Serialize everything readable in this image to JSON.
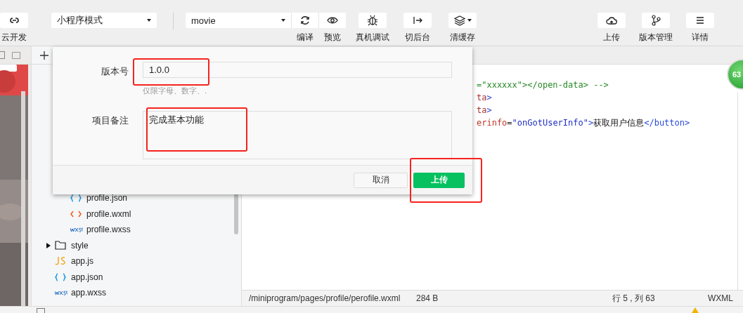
{
  "toolbar": {
    "left_tools": [
      {
        "label": "云开发",
        "kind": "cloud-dev",
        "has_menu": false
      }
    ],
    "mode_select": {
      "value": "小程序模式"
    },
    "project_select": {
      "value": "movie"
    },
    "project_tools": [
      {
        "label": "编译",
        "kind": "compile",
        "has_menu": false
      },
      {
        "label": "预览",
        "kind": "preview",
        "has_menu": false
      }
    ],
    "tools": [
      {
        "label": "真机调试",
        "kind": "debug",
        "has_menu": false
      },
      {
        "label": "切后台",
        "kind": "background",
        "has_menu": false
      },
      {
        "label": "清缓存",
        "kind": "cache",
        "has_menu": true
      }
    ],
    "right_tools": [
      {
        "label": "上传",
        "kind": "upload",
        "has_menu": false
      },
      {
        "label": "版本管理",
        "kind": "versions",
        "has_menu": false
      },
      {
        "label": "详情",
        "kind": "details",
        "has_menu": false
      }
    ]
  },
  "file_tree": [
    {
      "children": [
        {
          "name": "profile.json",
          "kind": "json"
        },
        {
          "name": "profile.wxml",
          "kind": "wxml"
        },
        {
          "name": "profile.wxss",
          "kind": "wxss"
        }
      ]
    },
    {
      "name": "style",
      "kind": "folder",
      "expanded": false
    },
    {
      "name": "app.js",
      "kind": "js"
    },
    {
      "name": "app.json",
      "kind": "json"
    },
    {
      "name": "app.wxss",
      "kind": "wxss"
    }
  ],
  "editor": {
    "code_lines": [
      [
        {
          "text": "=\"xxxxxx\"></open-data> -->",
          "kind": "comment"
        }
      ],
      [
        {
          "text": "ta",
          "kind": "tag"
        },
        {
          "text": ">",
          "kind": "bracket"
        }
      ],
      [
        {
          "text": "ta",
          "kind": "tag"
        },
        {
          "text": ">",
          "kind": "bracket"
        }
      ],
      [
        {
          "text": "erinfo",
          "kind": "attr"
        },
        {
          "text": "=",
          "kind": "plain"
        },
        {
          "text": "\"onGotUserInfo\"",
          "kind": "string"
        },
        {
          "text": ">",
          "kind": "bracket"
        },
        {
          "text": "获取用户信息",
          "kind": "plain"
        },
        {
          "text": "</button>",
          "kind": "bracket"
        }
      ]
    ],
    "status_bar": {
      "path": "/miniprogram/pages/profile/perofile.wxml",
      "size": "284 B",
      "position": "行 5 , 列 63",
      "language": "WXML"
    },
    "badge": "63"
  },
  "dialog": {
    "fields": [
      {
        "label": "版本号",
        "kind": "input",
        "value": "1.0.0",
        "hint": "仅限字母、数字、.",
        "highlighted": true
      },
      {
        "label": "项目备注",
        "kind": "textarea",
        "value": "完成基本功能",
        "highlighted": true
      }
    ],
    "buttons": [
      {
        "label": "取消",
        "kind": "secondary"
      },
      {
        "label": "上传",
        "kind": "primary",
        "highlighted": true
      }
    ]
  }
}
